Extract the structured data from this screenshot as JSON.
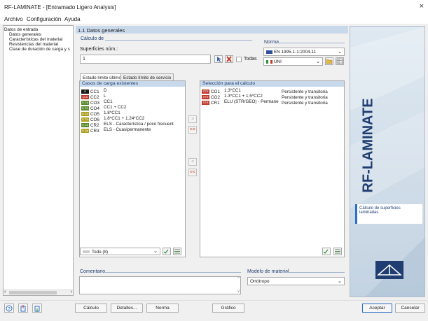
{
  "window": {
    "title": "RF-LAMINATE - [Entramado Ligero Analysis]",
    "close": "×"
  },
  "menu": [
    "Archivo",
    "Configuración",
    "Ayuda"
  ],
  "tree": {
    "root": "Datos de entrada",
    "items": [
      "Datos generales",
      "Características del material",
      "Resistencias del material",
      "Clase de duración de carga y s"
    ]
  },
  "section_title": "1.1 Datos generales",
  "calc": {
    "group": "Cálculo de",
    "surfaces_label": "Superficies núm.:",
    "surfaces_value": "1",
    "all_label": "Todas"
  },
  "norma": {
    "group": "Norma",
    "standard": "EN 1995-1-1:2004-11",
    "annex": "UNI"
  },
  "tabs": [
    "Estado límite último",
    "Estado límite de servicio"
  ],
  "existing": {
    "header": "Casos de carga existentes",
    "rows": [
      {
        "badge": "G",
        "color": "#1a1a1a",
        "code": "CC1",
        "desc": "D"
      },
      {
        "badge": "Qi A",
        "color": "#c0392b",
        "code": "CC2",
        "desc": "L"
      },
      {
        "badge": "S Ch",
        "color": "#5a8a2a",
        "code": "CO3",
        "desc": "CC1"
      },
      {
        "badge": "S Ch",
        "color": "#5a8a2a",
        "code": "CO4",
        "desc": "CC1 + CC2"
      },
      {
        "badge": "S Ch",
        "color": "#b0a020",
        "code": "CO5",
        "desc": "1.8*CC1"
      },
      {
        "badge": "S Ch",
        "color": "#b0a020",
        "code": "CO6",
        "desc": "1.8*CC1 + 1.24*CC2"
      },
      {
        "badge": "S Ch",
        "color": "#5a8a2a",
        "code": "CR2",
        "desc": "ELS - Característica / poco frecuent"
      },
      {
        "badge": "S Qp",
        "color": "#b0a020",
        "code": "CR3",
        "desc": "ELS - Cuasipermanente"
      }
    ],
    "filter": "Todo (8)"
  },
  "selected": {
    "header": "Selección para el cálculo",
    "rows": [
      {
        "badge": "STR",
        "color": "#c0392b",
        "code": "CO1",
        "desc": "1.3*CC1",
        "type": "Persistente y transitoria"
      },
      {
        "badge": "STR",
        "color": "#c0392b",
        "code": "CO2",
        "desc": "1.3*CC1 + 1.5*CC2",
        "type": "Persistente y transitoria"
      },
      {
        "badge": "STR",
        "color": "#c0392b",
        "code": "CR1",
        "desc": "ELU (STR/GEO) - Permane",
        "type": "Persistente y transitoria"
      }
    ]
  },
  "transfer": {
    "add": ">",
    "add_all": ">>",
    "remove": "<",
    "remove_all": "<<"
  },
  "comment": {
    "label": "Comentario",
    "value": ""
  },
  "material": {
    "label": "Modelo de material",
    "value": "Ortótropo"
  },
  "brand": {
    "product": "RF-LAMINATE",
    "caption": "Cálculo de superficies laminadas"
  },
  "buttons": {
    "calc": "Cálculo",
    "details": "Detalles...",
    "norma": "Norma",
    "graphics": "Gráfico",
    "accept": "Aceptar",
    "cancel": "Cancelar"
  },
  "colors": {
    "accent": "#2c6fc7",
    "header_bg": "#c9d9ec",
    "label": "#1f3d70"
  }
}
